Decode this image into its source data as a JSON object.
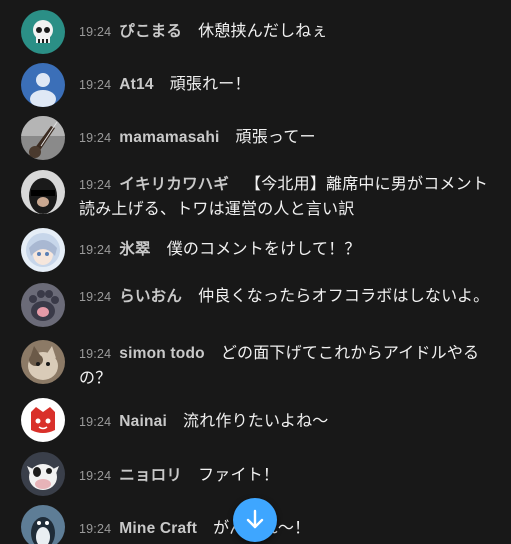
{
  "colors": {
    "background": "#181818",
    "timestamp": "#9a9a9a",
    "author": "#c9c9c9",
    "message": "#f1f1f1",
    "accent": "#3ea6ff"
  },
  "messages": [
    {
      "time": "19:24",
      "author": "ぴこまる",
      "text": "休憩挟んだしねぇ",
      "avatar_icon": "skull-avatar-icon"
    },
    {
      "time": "19:24",
      "author": "At14",
      "text": "頑張れー！",
      "avatar_icon": "default-user-avatar-icon"
    },
    {
      "time": "19:24",
      "author": "mamamasahi",
      "text": "頑張ってー",
      "avatar_icon": "guitar-avatar-icon"
    },
    {
      "time": "19:24",
      "author": "イキリカワハギ",
      "text": "【今北用】離席中に男がコメント読み上げる、トワは運営の人と言い訳",
      "avatar_icon": "photo-avatar-icon"
    },
    {
      "time": "19:24",
      "author": "氷翠",
      "text": "僕のコメントをけして！？",
      "avatar_icon": "anime-girl-avatar-icon"
    },
    {
      "time": "19:24",
      "author": "らいおん",
      "text": "仲良くなったらオフコラボはしないよ。",
      "avatar_icon": "cat-paw-avatar-icon"
    },
    {
      "time": "19:24",
      "author": "simon todo",
      "text": "どの面下げてこれからアイドルやるの？",
      "avatar_icon": "cat-avatar-icon"
    },
    {
      "time": "19:24",
      "author": "Nainai",
      "text": "流れ作りたいよね～",
      "avatar_icon": "red-mascot-avatar-icon"
    },
    {
      "time": "19:24",
      "author": "ニョロリ",
      "text": "ファイト！",
      "avatar_icon": "cow-avatar-icon"
    },
    {
      "time": "19:24",
      "author": "Mine Craft",
      "text": "がんばれ～！",
      "avatar_icon": "penguin-avatar-icon"
    }
  ],
  "scroll_button": {
    "icon": "arrow-down-icon"
  }
}
